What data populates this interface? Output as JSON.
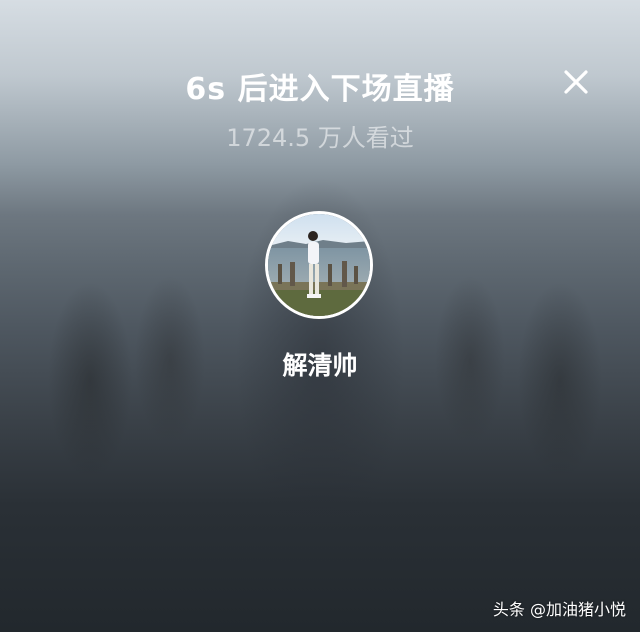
{
  "header": {
    "countdown_title": "6s 后进入下场直播",
    "viewers": "1724.5 万人看过"
  },
  "close": {
    "icon": "close-icon"
  },
  "streamer": {
    "name": "解清帅",
    "avatar_icon": "avatar-photo"
  },
  "watermark": "头条 @加油猪小悦"
}
